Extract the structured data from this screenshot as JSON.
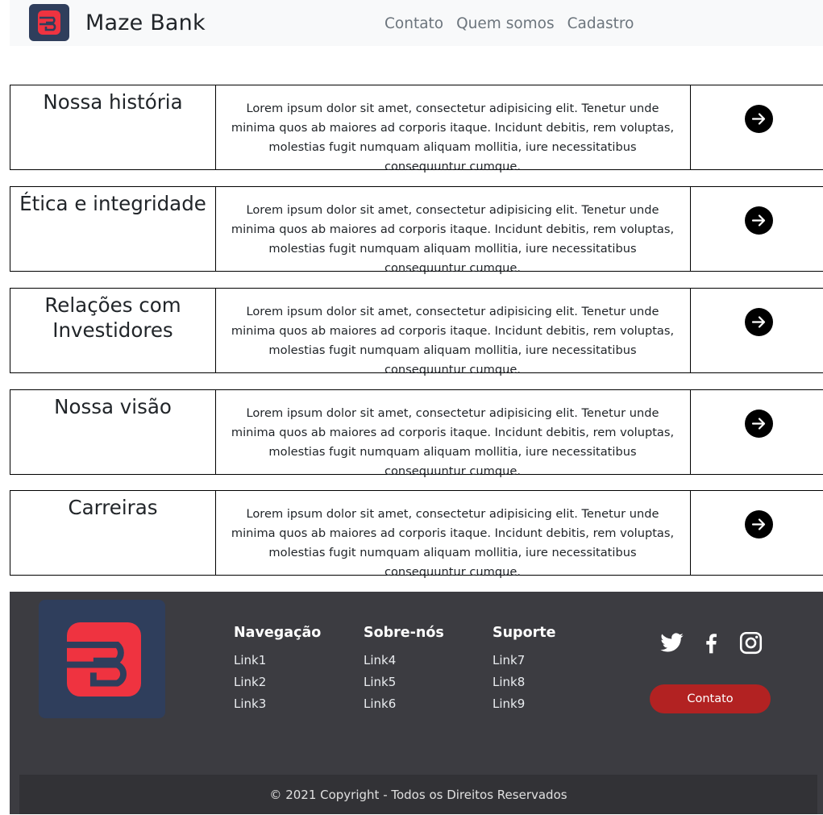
{
  "navbar": {
    "brand": "Maze Bank",
    "links": [
      "Contato",
      "Quem somos",
      "Cadastro"
    ]
  },
  "sections": [
    {
      "title": "Nossa história",
      "text": "Lorem ipsum dolor sit amet, consectetur adipisicing elit. Tenetur unde minima quos ab maiores ad corporis itaque. Incidunt debitis, rem voluptas, molestias fugit numquam aliquam mollitia, iure necessitatibus consequuntur cumque."
    },
    {
      "title": "Ética e integridade",
      "text": "Lorem ipsum dolor sit amet, consectetur adipisicing elit. Tenetur unde minima quos ab maiores ad corporis itaque. Incidunt debitis, rem voluptas, molestias fugit numquam aliquam mollitia, iure necessitatibus consequuntur cumque."
    },
    {
      "title": "Relações com Investidores",
      "text": "Lorem ipsum dolor sit amet, consectetur adipisicing elit. Tenetur unde minima quos ab maiores ad corporis itaque. Incidunt debitis, rem voluptas, molestias fugit numquam aliquam mollitia, iure necessitatibus consequuntur cumque."
    },
    {
      "title": "Nossa visão",
      "text": "Lorem ipsum dolor sit amet, consectetur adipisicing elit. Tenetur unde minima quos ab maiores ad corporis itaque. Incidunt debitis, rem voluptas, molestias fugit numquam aliquam mollitia, iure necessitatibus consequuntur cumque."
    },
    {
      "title": "Carreiras",
      "text": "Lorem ipsum dolor sit amet, consectetur adipisicing elit. Tenetur unde minima quos ab maiores ad corporis itaque. Incidunt debitis, rem voluptas, molestias fugit numquam aliquam mollitia, iure necessitatibus consequuntur cumque."
    }
  ],
  "footer": {
    "columns": [
      {
        "title": "Navegação",
        "links": [
          "Link1",
          "Link2",
          "Link3"
        ]
      },
      {
        "title": "Sobre-nós",
        "links": [
          "Link4",
          "Link5",
          "Link6"
        ]
      },
      {
        "title": "Suporte",
        "links": [
          "Link7",
          "Link8",
          "Link9"
        ]
      }
    ],
    "social_icons": [
      "twitter-icon",
      "facebook-icon",
      "instagram-icon"
    ],
    "contact_button": "Contato",
    "copyright": "© 2021 Copyright - Todos os Direitos Reservados"
  },
  "colors": {
    "logo_bg": "#2f3e5c",
    "logo_red": "#ef3340",
    "footer_bg": "#3c3c41",
    "contact_button": "#b22222"
  }
}
